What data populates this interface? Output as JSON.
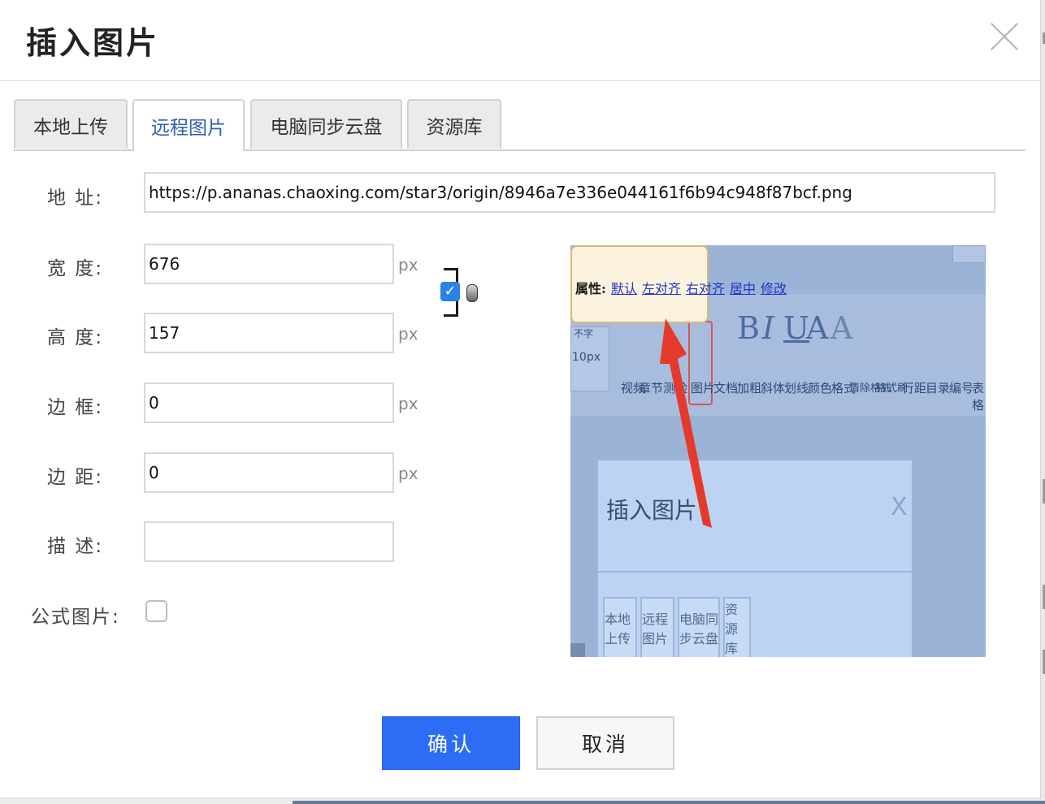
{
  "dialog": {
    "title": "插入图片",
    "close_icon": "close-icon"
  },
  "tabs": [
    {
      "label": "本地上传",
      "active": false
    },
    {
      "label": "远程图片",
      "active": true
    },
    {
      "label": "电脑同步云盘",
      "active": false
    },
    {
      "label": "资源库",
      "active": false
    }
  ],
  "form": {
    "url_label": "地 址:",
    "url_value": "https://p.ananas.chaoxing.com/star3/origin/8946a7e336e044161f6b94c948f87bcf.png",
    "width_label": "宽 度:",
    "width_value": "676",
    "height_label": "高 度:",
    "height_value": "157",
    "border_label": "边 框:",
    "border_value": "0",
    "margin_label": "边 距:",
    "margin_value": "0",
    "desc_label": "描 述:",
    "desc_value": "",
    "unit": "px",
    "formula_label": "公式图片:",
    "formula_checked": false,
    "lock_ratio_checked": true
  },
  "preview": {
    "popup_label": "属性:",
    "popup_links": [
      "默认",
      "左对齐",
      "右对齐",
      "居中",
      "修改"
    ],
    "toolbar_icons": [
      "B",
      "I",
      "U",
      "A",
      "A"
    ],
    "toolbar_labels": [
      "视频",
      "章节测验",
      "图片",
      "文档",
      "加粗",
      "斜体",
      "划线",
      "颜色",
      "格式",
      "清除格式",
      "格式刷",
      "行距",
      "目录",
      "编号",
      "表格"
    ],
    "left_texts": [
      "不字",
      "10px"
    ],
    "inner_title": "插入图片",
    "inner_close": "X",
    "inner_tabs": [
      "本地上传",
      "远程图片",
      "电脑同步云盘",
      "资源库"
    ],
    "arrow_color": "#e53a2b"
  },
  "buttons": {
    "confirm": "确认",
    "cancel": "取消"
  },
  "colors": {
    "primary": "#2d6df6",
    "active_tab_text": "#2b5fb0"
  }
}
